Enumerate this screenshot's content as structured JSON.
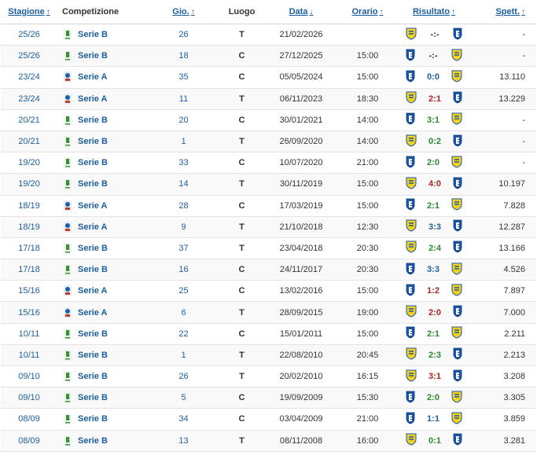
{
  "headers": {
    "season": "Stagione",
    "competition": "Competizione",
    "matchday": "Gio.",
    "location": "Luogo",
    "date": "Data",
    "time": "Orario",
    "result": "Risultato",
    "spectators": "Spett.",
    "sort_up": "↑",
    "sort_down": "↓"
  },
  "colors": {
    "link": "#1d5fa0",
    "win": "#2a8a2a",
    "loss": "#b22222",
    "draw": "#1d5fa0",
    "frosinone_yellow": "#f2d21e",
    "empoli_blue": "#1a56a8"
  },
  "rows": [
    {
      "season": "25/26",
      "comp_icon": "serie-b-logo",
      "comp": "Serie B",
      "day": "26",
      "loc": "T",
      "date": "21/02/2026",
      "time": "",
      "home": "frosinone",
      "away": "empoli",
      "score": "-:-",
      "res": "none",
      "spec": "-"
    },
    {
      "season": "25/26",
      "comp_icon": "serie-b-logo",
      "comp": "Serie B",
      "day": "18",
      "loc": "C",
      "date": "27/12/2025",
      "time": "15:00",
      "home": "empoli",
      "away": "frosinone",
      "score": "-:-",
      "res": "none",
      "spec": "-"
    },
    {
      "season": "23/24",
      "comp_icon": "serie-a-logo",
      "comp": "Serie A",
      "day": "35",
      "loc": "C",
      "date": "05/05/2024",
      "time": "15:00",
      "home": "empoli",
      "away": "frosinone",
      "score": "0:0",
      "res": "draw",
      "spec": "13.110"
    },
    {
      "season": "23/24",
      "comp_icon": "serie-a-logo",
      "comp": "Serie A",
      "day": "11",
      "loc": "T",
      "date": "06/11/2023",
      "time": "18:30",
      "home": "frosinone",
      "away": "empoli",
      "score": "2:1",
      "res": "loss",
      "spec": "13.229"
    },
    {
      "season": "20/21",
      "comp_icon": "serie-b-logo",
      "comp": "Serie B",
      "day": "20",
      "loc": "C",
      "date": "30/01/2021",
      "time": "14:00",
      "home": "empoli",
      "away": "frosinone",
      "score": "3:1",
      "res": "win",
      "spec": "-"
    },
    {
      "season": "20/21",
      "comp_icon": "serie-b-logo",
      "comp": "Serie B",
      "day": "1",
      "loc": "T",
      "date": "26/09/2020",
      "time": "14:00",
      "home": "frosinone",
      "away": "empoli",
      "score": "0:2",
      "res": "win",
      "spec": "-"
    },
    {
      "season": "19/20",
      "comp_icon": "serie-b-logo",
      "comp": "Serie B",
      "day": "33",
      "loc": "C",
      "date": "10/07/2020",
      "time": "21:00",
      "home": "empoli",
      "away": "frosinone",
      "score": "2:0",
      "res": "win",
      "spec": "-"
    },
    {
      "season": "19/20",
      "comp_icon": "serie-b-logo",
      "comp": "Serie B",
      "day": "14",
      "loc": "T",
      "date": "30/11/2019",
      "time": "15:00",
      "home": "frosinone",
      "away": "empoli",
      "score": "4:0",
      "res": "loss",
      "spec": "10.197"
    },
    {
      "season": "18/19",
      "comp_icon": "serie-a-logo",
      "comp": "Serie A",
      "day": "28",
      "loc": "C",
      "date": "17/03/2019",
      "time": "15:00",
      "home": "empoli",
      "away": "frosinone",
      "score": "2:1",
      "res": "win",
      "spec": "7.828"
    },
    {
      "season": "18/19",
      "comp_icon": "serie-a-logo",
      "comp": "Serie A",
      "day": "9",
      "loc": "T",
      "date": "21/10/2018",
      "time": "12:30",
      "home": "frosinone",
      "away": "empoli",
      "score": "3:3",
      "res": "draw",
      "spec": "12.287"
    },
    {
      "season": "17/18",
      "comp_icon": "serie-b-logo",
      "comp": "Serie B",
      "day": "37",
      "loc": "T",
      "date": "23/04/2018",
      "time": "20:30",
      "home": "frosinone",
      "away": "empoli",
      "score": "2:4",
      "res": "win",
      "spec": "13.166"
    },
    {
      "season": "17/18",
      "comp_icon": "serie-b-logo",
      "comp": "Serie B",
      "day": "16",
      "loc": "C",
      "date": "24/11/2017",
      "time": "20:30",
      "home": "empoli",
      "away": "frosinone",
      "score": "3:3",
      "res": "draw",
      "spec": "4.526"
    },
    {
      "season": "15/16",
      "comp_icon": "serie-a-logo",
      "comp": "Serie A",
      "day": "25",
      "loc": "C",
      "date": "13/02/2016",
      "time": "15:00",
      "home": "empoli",
      "away": "frosinone",
      "score": "1:2",
      "res": "loss",
      "spec": "7.897"
    },
    {
      "season": "15/16",
      "comp_icon": "serie-a-logo",
      "comp": "Serie A",
      "day": "6",
      "loc": "T",
      "date": "28/09/2015",
      "time": "19:00",
      "home": "frosinone",
      "away": "empoli",
      "score": "2:0",
      "res": "loss",
      "spec": "7.000"
    },
    {
      "season": "10/11",
      "comp_icon": "serie-b-logo",
      "comp": "Serie B",
      "day": "22",
      "loc": "C",
      "date": "15/01/2011",
      "time": "15:00",
      "home": "empoli",
      "away": "frosinone",
      "score": "2:1",
      "res": "win",
      "spec": "2.211"
    },
    {
      "season": "10/11",
      "comp_icon": "serie-b-logo",
      "comp": "Serie B",
      "day": "1",
      "loc": "T",
      "date": "22/08/2010",
      "time": "20:45",
      "home": "frosinone",
      "away": "empoli",
      "score": "2:3",
      "res": "win",
      "spec": "2.213"
    },
    {
      "season": "09/10",
      "comp_icon": "serie-b-logo",
      "comp": "Serie B",
      "day": "26",
      "loc": "T",
      "date": "20/02/2010",
      "time": "16:15",
      "home": "frosinone",
      "away": "empoli",
      "score": "3:1",
      "res": "loss",
      "spec": "3.208"
    },
    {
      "season": "09/10",
      "comp_icon": "serie-b-logo",
      "comp": "Serie B",
      "day": "5",
      "loc": "C",
      "date": "19/09/2009",
      "time": "15:30",
      "home": "empoli",
      "away": "frosinone",
      "score": "2:0",
      "res": "win",
      "spec": "3.305"
    },
    {
      "season": "08/09",
      "comp_icon": "serie-b-logo",
      "comp": "Serie B",
      "day": "34",
      "loc": "C",
      "date": "03/04/2009",
      "time": "21:00",
      "home": "empoli",
      "away": "frosinone",
      "score": "1:1",
      "res": "draw",
      "spec": "3.859"
    },
    {
      "season": "08/09",
      "comp_icon": "serie-b-logo",
      "comp": "Serie B",
      "day": "13",
      "loc": "T",
      "date": "08/11/2008",
      "time": "16:00",
      "home": "frosinone",
      "away": "empoli",
      "score": "0:1",
      "res": "win",
      "spec": "3.281"
    }
  ]
}
